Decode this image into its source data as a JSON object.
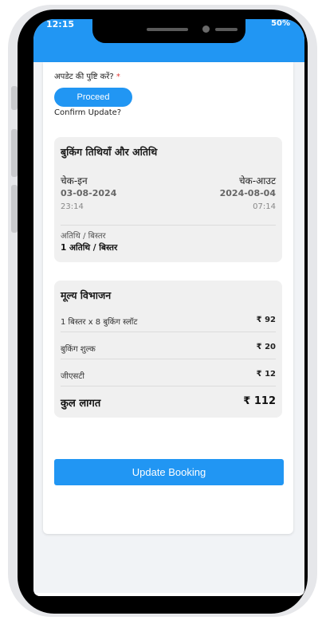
{
  "status": {
    "time": "12:15",
    "right": "50%"
  },
  "confirm": {
    "question_hi": "अपडेट की पुष्टि करें?",
    "required_mark": "*",
    "proceed_label": "Proceed",
    "question_en": "Confirm Update?"
  },
  "booking": {
    "title": "बुकिंग तिथियाँ और अतिथि",
    "checkin": {
      "label": "चेक-इन",
      "date": "03-08-2024",
      "time": "23:14"
    },
    "checkout": {
      "label": "चेक-आउट",
      "date": "2024-08-04",
      "time": "07:14"
    },
    "guests": {
      "label": "अतिथि / बिस्तर",
      "value": "1 अतिथि / बिस्तर"
    }
  },
  "price": {
    "title": "मूल्य विभाजन",
    "rows": [
      {
        "label": "1 बिस्तर x 8 बुकिंग स्लॉट",
        "amount": "₹ 92"
      },
      {
        "label": "बुकिंग शुल्क",
        "amount": "₹ 20"
      },
      {
        "label": "जीएसटी",
        "amount": "₹ 12"
      }
    ],
    "total": {
      "label": "कुल लागत",
      "amount": "₹ 112"
    }
  },
  "actions": {
    "update_label": "Update Booking"
  },
  "colors": {
    "primary": "#2196f3",
    "required": "#e53935"
  }
}
